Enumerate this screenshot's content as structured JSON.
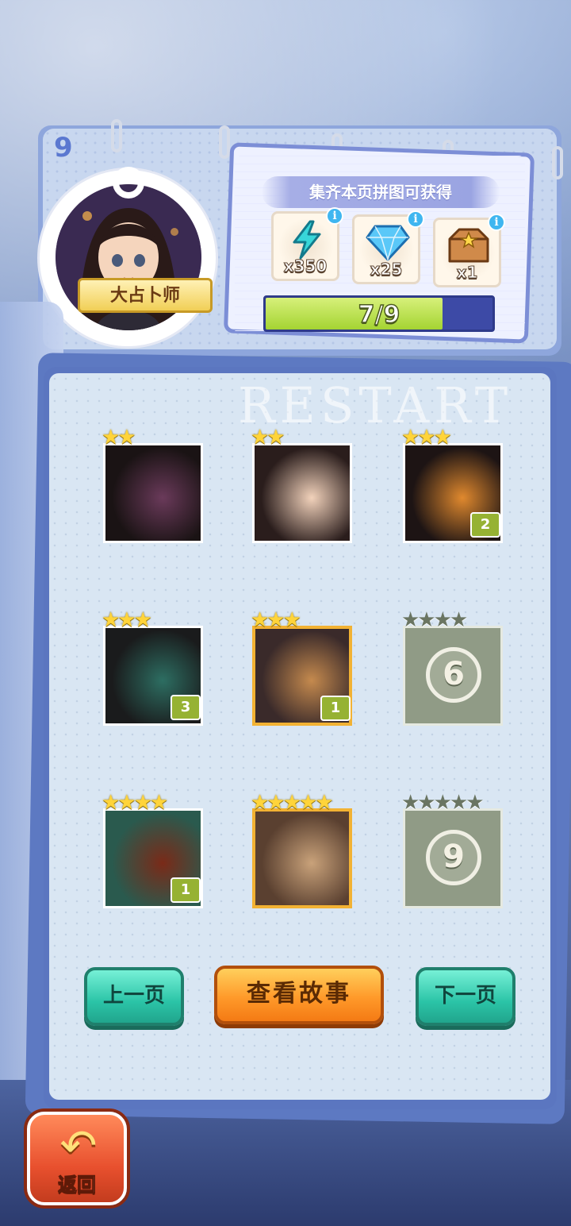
{
  "level": {
    "number": "9"
  },
  "character": {
    "name": "大占卜师"
  },
  "rewards": {
    "title": "集齐本页拼图可获得",
    "items": [
      {
        "icon": "lightning-energy-icon",
        "qty": "x350",
        "info": "i"
      },
      {
        "icon": "diamond-gem-icon",
        "qty": "x25",
        "info": "i"
      },
      {
        "icon": "treasure-chest-icon",
        "qty": "x1",
        "info": "i"
      }
    ]
  },
  "progress": {
    "text": "7/9",
    "collected": 7,
    "total": 9,
    "fill_fraction": 0.78
  },
  "watermark": "RESTART",
  "pieces": [
    {
      "index": 1,
      "stars": 2,
      "max_stars": 2,
      "count": "",
      "unlocked": true
    },
    {
      "index": 2,
      "stars": 2,
      "max_stars": 2,
      "count": "",
      "unlocked": true
    },
    {
      "index": 3,
      "stars": 3,
      "max_stars": 3,
      "count": "2",
      "unlocked": true
    },
    {
      "index": 4,
      "stars": 3,
      "max_stars": 3,
      "count": "3",
      "unlocked": true
    },
    {
      "index": 5,
      "stars": 3,
      "max_stars": 3,
      "count": "1",
      "unlocked": true,
      "selected": true
    },
    {
      "index": 6,
      "stars": 0,
      "max_stars": 4,
      "label": "6",
      "unlocked": false
    },
    {
      "index": 7,
      "stars": 4,
      "max_stars": 4,
      "count": "1",
      "unlocked": true
    },
    {
      "index": 8,
      "stars": 5,
      "max_stars": 5,
      "count": "",
      "unlocked": true,
      "selected": true
    },
    {
      "index": 9,
      "stars": 0,
      "max_stars": 5,
      "label": "9",
      "unlocked": false
    }
  ],
  "buttons": {
    "prev": "上一页",
    "story": "查看故事",
    "next": "下一页",
    "back": "返回"
  },
  "star_glyph": "★",
  "colors": {
    "accent_orange": "#ff9a2a",
    "teal": "#2bc4a7",
    "progress_green": "#a4d432",
    "locked_grey": "#909b86",
    "badge_green": "#96b233"
  }
}
